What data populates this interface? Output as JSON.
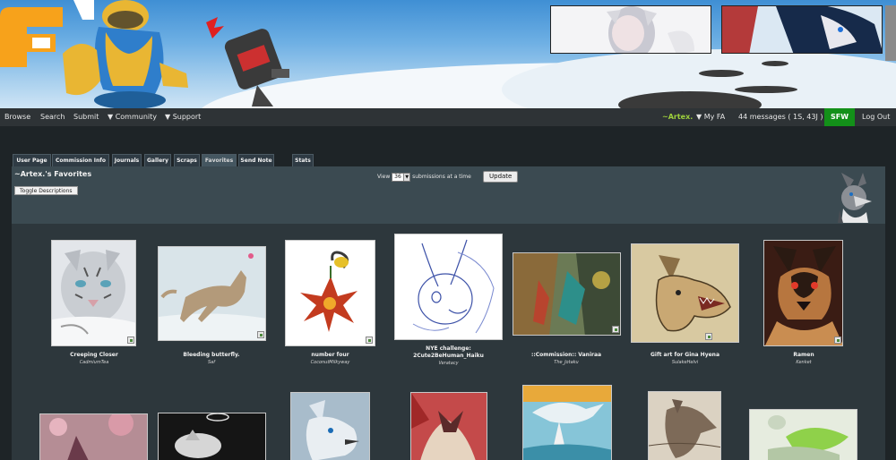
{
  "nav": {
    "browse": "Browse",
    "search": "Search",
    "submit": "Submit",
    "community": "▼ Community",
    "support": "▼ Support",
    "username": "~Artex.",
    "myfa": "▼ My FA",
    "messages": "44 messages ( 1S, 43J )",
    "sfw": "SFW",
    "logout": "Log Out"
  },
  "tabs": [
    {
      "label": "User Page"
    },
    {
      "label": "Commission Info"
    },
    {
      "label": "Journals"
    },
    {
      "label": "Gallery"
    },
    {
      "label": "Scraps"
    },
    {
      "label": "Favorites"
    },
    {
      "label": "Send Note"
    },
    {
      "label": "Stats"
    }
  ],
  "header": {
    "title": "~Artex.'s Favorites",
    "toggle_label": "Toggle Descriptions",
    "view_prefix": "View",
    "view_count": "36",
    "view_suffix": "submissions at a time",
    "update_label": "Update"
  },
  "submissions": [
    {
      "title": "Creeping Closer",
      "artist": "CadmiumTea"
    },
    {
      "title": "Bleeding butterfly.",
      "artist": "Saf"
    },
    {
      "title": "number four",
      "artist": "CoconutMilkyway"
    },
    {
      "title": "NYE challenge:",
      "title2": "2Cute2BeHuman_Haiku",
      "artist": "Veratacy"
    },
    {
      "title": "::Commission:: Vaniraa",
      "artist": "The_Jotaku"
    },
    {
      "title": "Gift art for Gina Hyena",
      "artist": "SulakeHelvi"
    },
    {
      "title": "Ramen",
      "artist": "Kenket"
    }
  ],
  "colors": {
    "accent_user": "#9ed03c",
    "sfw_badge": "#139019",
    "navbar_bg": "#2e3336",
    "panel_bg": "#3b4a51",
    "gallery_bg": "#2d373c"
  }
}
